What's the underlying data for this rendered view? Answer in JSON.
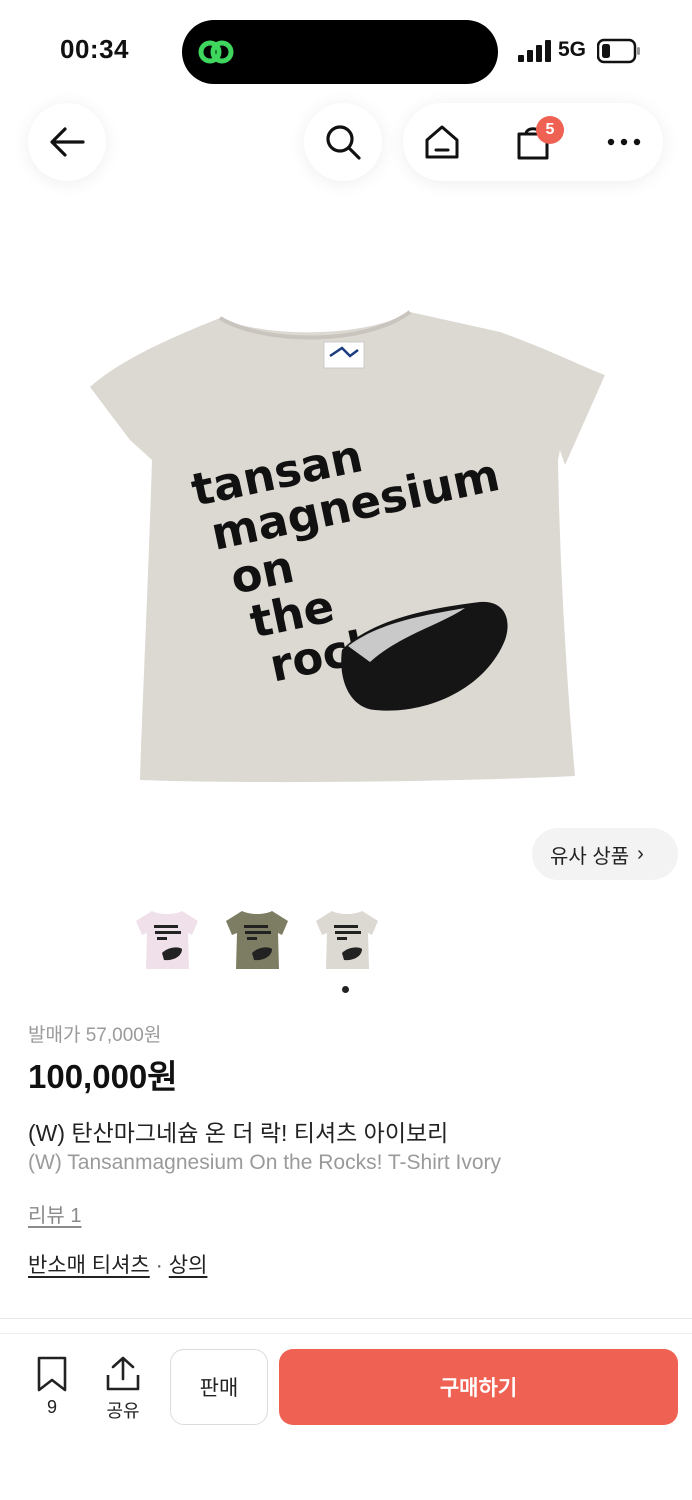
{
  "status": {
    "time": "00:34",
    "network": "5G"
  },
  "nav": {
    "cart_count": "5"
  },
  "similar": {
    "label": "유사 상품",
    "chevron": "›"
  },
  "product": {
    "original_price": "발매가 57,000원",
    "price": "100,000원",
    "name_kr": "(W) 탄산마그네슘 온 더 락! 티셔츠 아이보리",
    "name_en": "(W) Tansanmagnesium On the Rocks! T-Shirt Ivory",
    "review": "리뷰 1",
    "category1": "반소매 티셔츠",
    "category_sep": "·",
    "category2": "상의",
    "shirt_text": [
      "tansan",
      "magnesium",
      "on",
      "the",
      "rocks!"
    ],
    "thumbnails": [
      "pink",
      "olive",
      "ivory"
    ]
  },
  "bottom": {
    "bookmark_count": "9",
    "share_label": "공유",
    "sell_label": "판매",
    "buy_label": "구매하기"
  },
  "colors": {
    "accent": "#ef6253",
    "shirt_ivory": "#dcd8d2",
    "shirt_pink": "#efe0ea",
    "shirt_olive": "#7c7d62"
  }
}
